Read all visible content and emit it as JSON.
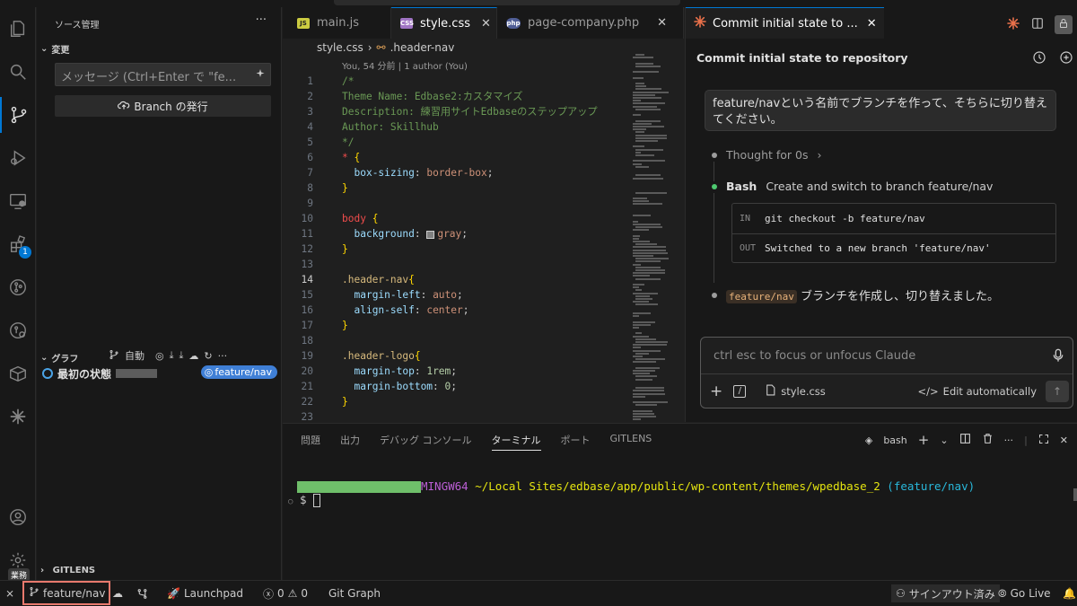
{
  "sidebar": {
    "title": "ソース管理",
    "changes_label": "変更",
    "commit_placeholder": "メッセージ (Ctrl+Enter で \"fe...",
    "publish_label": "Branch の発行",
    "graph_label": "グラフ",
    "graph_auto_label": "自動",
    "graph_row_label": "最初の状態",
    "graph_branch_pill": "feature/nav",
    "gitlens_label": "GITLENS",
    "work_badge": "業務",
    "extensions_badge": "1"
  },
  "editor": {
    "tabs": [
      {
        "label": "main.js",
        "badge": "JS",
        "badge_color": "#cbcb41"
      },
      {
        "label": "style.css",
        "badge": "CSS",
        "badge_color": "#a074c4"
      },
      {
        "label": "page-company.php",
        "badge": "php",
        "badge_color": "#4f5d95"
      }
    ],
    "breadcrumb_file": "style.css",
    "breadcrumb_symbol": ".header-nav",
    "blame": "You, 54 分前 | 1 author (You)",
    "line_numbers": [
      "1",
      "2",
      "3",
      "4",
      "5",
      "6",
      "7",
      "8",
      "9",
      "10",
      "11",
      "12",
      "13",
      "14",
      "15",
      "16",
      "17",
      "18",
      "19",
      "20",
      "21",
      "22",
      "23"
    ],
    "code": {
      "l1": "/*",
      "l2": "Theme Name: Edbase2:カスタマイズ",
      "l3": "Description: 練習用サイトEdbaseのステップアップ",
      "l4": "Author: Skillhub",
      "l5": "*/",
      "l6_sel": "*",
      "l6_brace": " {",
      "l7_prop": "box-sizing",
      "l7_val": "border-box",
      "l8": "}",
      "l10_sel": "body",
      "l10_brace": " {",
      "l11_prop": "background",
      "l11_val": "gray",
      "l12": "}",
      "l14_sel": ".header-nav",
      "l14_brace": "{",
      "l15_prop": "margin-left",
      "l15_val": "auto",
      "l16_prop": "align-self",
      "l16_val": "center",
      "l17": "}",
      "l19_sel": ".header-logo",
      "l19_brace": "{",
      "l20_prop": "margin-top",
      "l20_val": "1rem",
      "l21_prop": "margin-bottom",
      "l21_val": "0",
      "l22": "}"
    }
  },
  "chat": {
    "tab_label": "Commit initial state to ...",
    "title": "Commit initial state to repository",
    "user_message": "feature/navという名前でブランチを作って、そちらに切り替えてください。",
    "thought": "Thought for 0s",
    "bash_label": "Bash",
    "bash_desc": "Create and switch to branch feature/nav",
    "in_tag": "IN",
    "in_cmd": "git checkout -b feature/nav",
    "out_tag": "OUT",
    "out_text": "Switched to a new branch 'feature/nav'",
    "result_chip": "feature/nav",
    "result_text": "ブランチを作成し、切り替えました。",
    "input_placeholder": "ctrl esc to focus or unfocus Claude",
    "attach_file": "style.css",
    "edit_mode": "Edit automatically"
  },
  "panel": {
    "tabs": [
      "問題",
      "出力",
      "デバッグ コンソール",
      "ターミナル",
      "ポート",
      "GITLENS"
    ],
    "active_tab": "ターミナル",
    "shell_label": "bash",
    "term_host": "MINGW64",
    "term_path": "~/Local Sites/edbase/app/public/wp-content/themes/wpedbase_2",
    "term_branch": "(feature/nav)",
    "term_prompt": "$"
  },
  "status": {
    "branch": "feature/nav",
    "launchpad": "Launchpad",
    "errors": "0",
    "warnings": "0",
    "git_graph": "Git Graph",
    "signout": "サインアウト済み",
    "golive": "Go Live"
  },
  "colors": {
    "accent": "#0078d4",
    "branch_highlight": "#e8796d",
    "claude_orange": "#e8704a"
  }
}
